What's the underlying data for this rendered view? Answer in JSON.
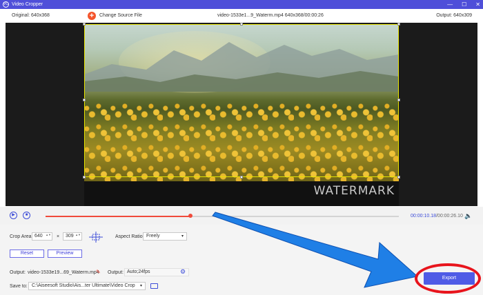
{
  "window": {
    "title": "Video Cropper",
    "icon_glyph": "VC",
    "controls": {
      "minimize": "—",
      "maximize": "☐",
      "close": "✕"
    }
  },
  "source": {
    "original_size": "Original: 640x368",
    "add_icon": "+",
    "change_source": "Change Source File",
    "file_info": "video-1533e1...9_Waterm.mp4     640x368/00:00:26",
    "output_size": "Output: 640x309"
  },
  "video": {
    "watermark": "WATERMARK"
  },
  "playback": {
    "play_icon": "▶",
    "stop_icon": "■",
    "progress": 0.41,
    "current_time": "00:00:10.18",
    "total_time": "/00:00:26.10",
    "volume_icon": "🔈"
  },
  "crop": {
    "area_label": "Crop Area:",
    "width": "640",
    "times": "×",
    "height": "309",
    "spin_glyph": "▲▼",
    "aspect_label": "Aspect Ratio:",
    "aspect_value": "Freely",
    "caret": "▾",
    "reset": "Reset",
    "preview": "Preview"
  },
  "output": {
    "label": "Output:",
    "filename": "video-1533e19...69_Waterm.mp4",
    "pencil_icon": "✎",
    "settings_label": "Output:",
    "settings_value": "Auto;24fps",
    "gear_icon": "⚙",
    "save_label": "Save to:",
    "save_path": "C:\\Aiseesoft Studio\\Ais...ter Ultimate\\Video Crop",
    "export": "Export"
  },
  "colors": {
    "accent": "#4f5be6",
    "progress": "#f04a3b",
    "arrow": "#1f7fe6",
    "ring": "#e8141c"
  }
}
